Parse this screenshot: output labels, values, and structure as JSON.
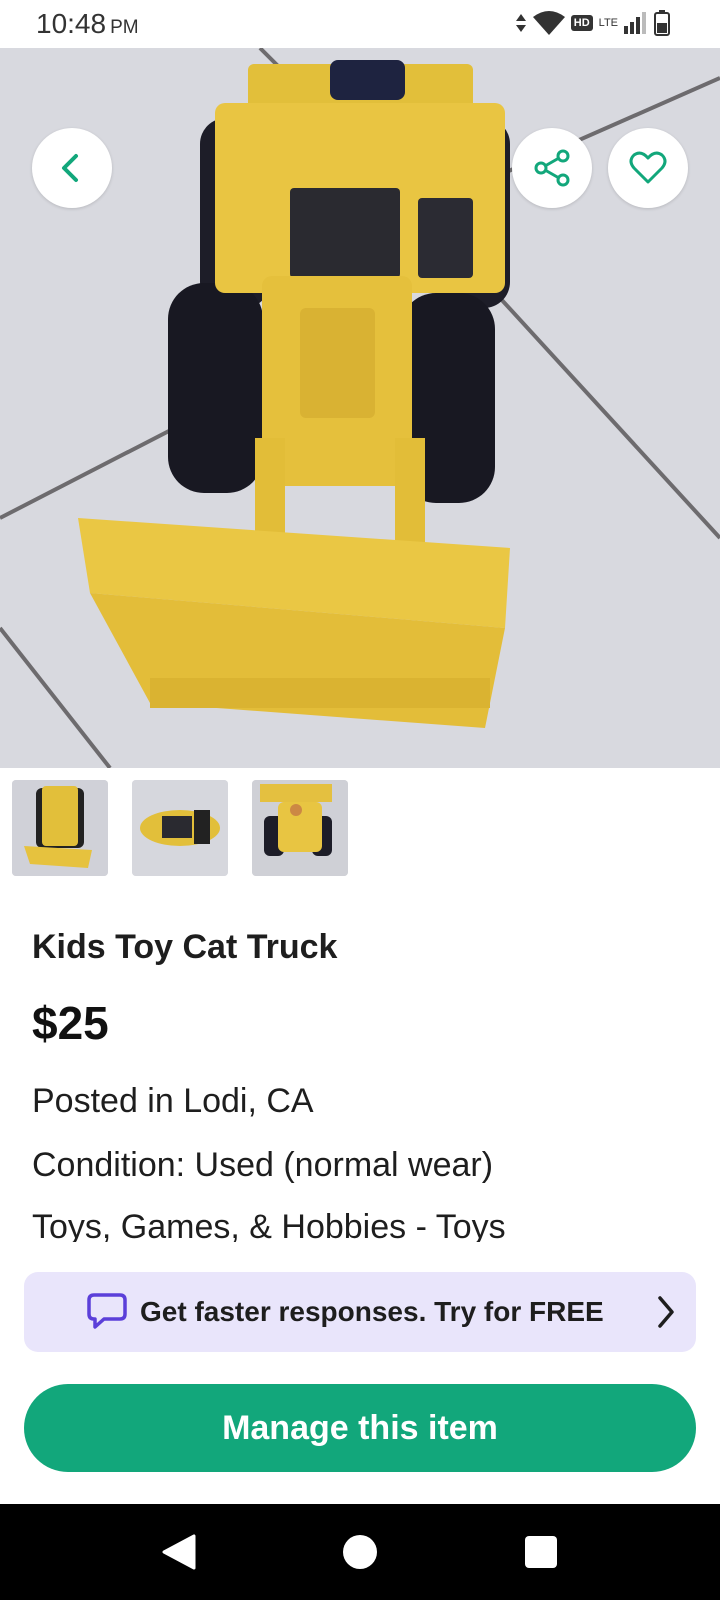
{
  "status_bar": {
    "time": "10:48",
    "ampm": "PM",
    "hd": "HD",
    "network": "LTE"
  },
  "header_icons": {
    "back": "chevron-left-icon",
    "share": "share-icon",
    "favorite": "heart-icon"
  },
  "listing": {
    "title": "Kids Toy Cat Truck",
    "price": "$25",
    "posted": "Posted in Lodi, CA",
    "condition": "Condition: Used (normal wear)",
    "category": "Toys, Games, & Hobbies - Toys"
  },
  "promo": {
    "text": "Get faster responses. Try for FREE",
    "icon": "chat-bubble-icon"
  },
  "actions": {
    "manage_label": "Manage this item"
  },
  "colors": {
    "accent": "#12a77b",
    "promo_bg": "#e9e5fb",
    "promo_icon": "#5b3fd9"
  }
}
